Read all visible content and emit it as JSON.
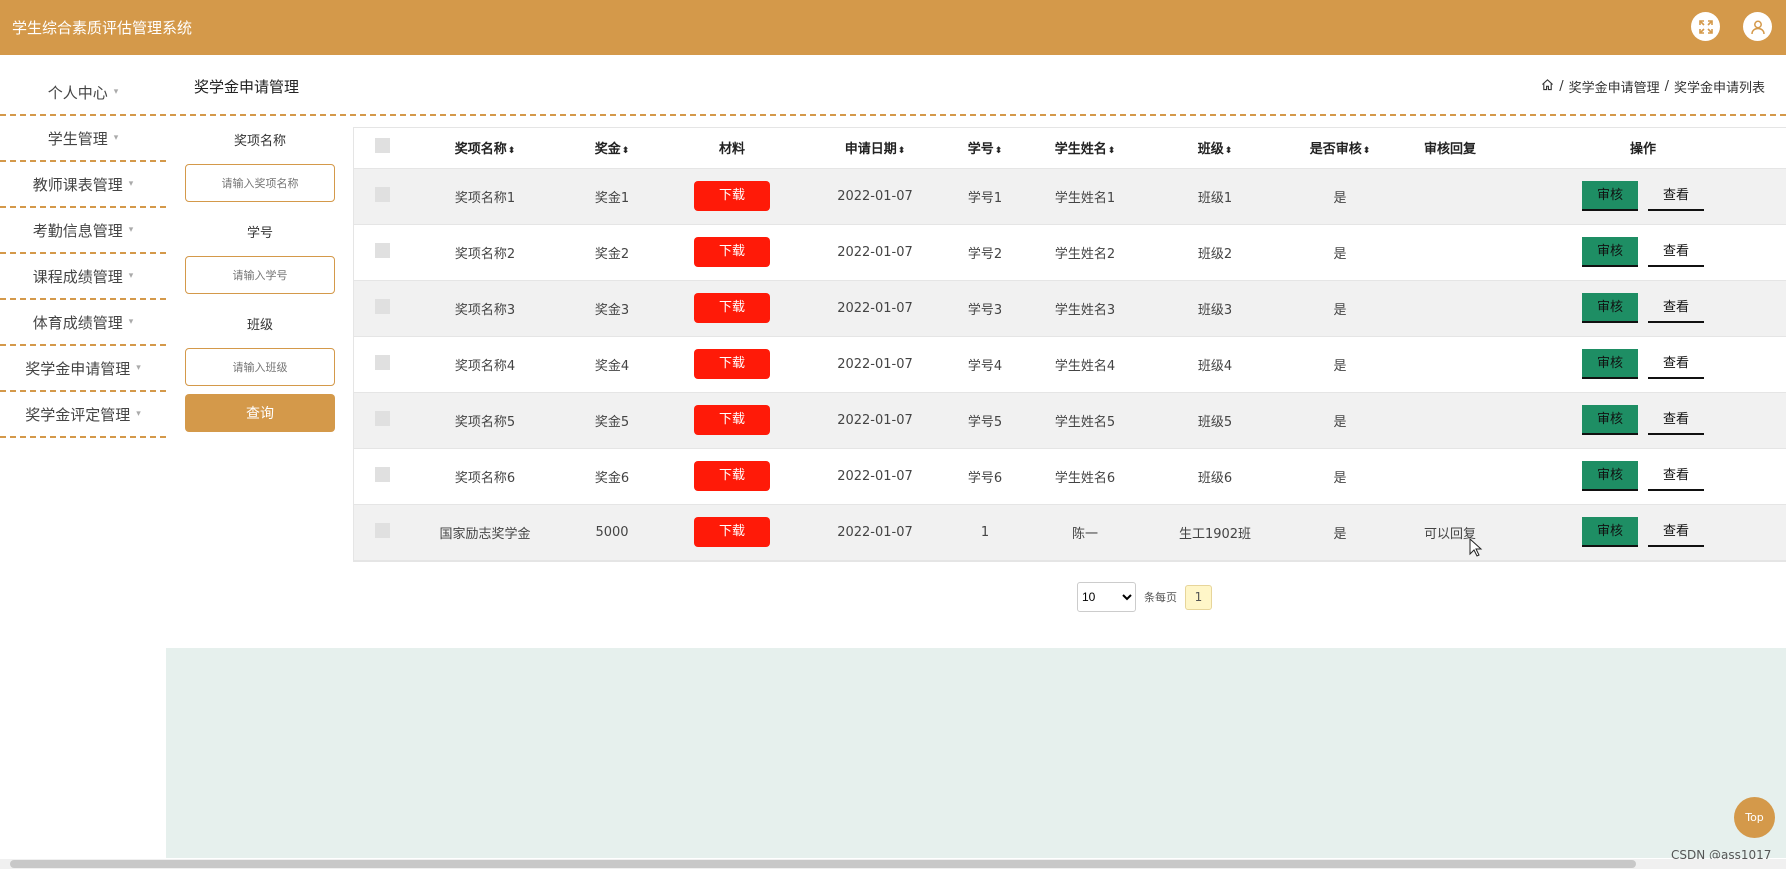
{
  "header": {
    "app_title": "学生综合素质评估管理系统",
    "icons": [
      "fullscreen-icon",
      "user-icon"
    ]
  },
  "sidebar": {
    "items": [
      {
        "label": "个人中心"
      },
      {
        "label": "学生管理"
      },
      {
        "label": "教师课表管理"
      },
      {
        "label": "考勤信息管理"
      },
      {
        "label": "课程成绩管理"
      },
      {
        "label": "体育成绩管理"
      },
      {
        "label": "奖学金申请管理"
      },
      {
        "label": "奖学金评定管理"
      }
    ],
    "caret": "▾"
  },
  "page": {
    "title": "奖学金申请管理",
    "breadcrumb": {
      "level1": "奖学金申请管理",
      "separator": "/",
      "level2": "奖学金申请列表"
    }
  },
  "filters": {
    "award_name": {
      "label": "奖项名称",
      "placeholder": "请输入奖项名称"
    },
    "student_no": {
      "label": "学号",
      "placeholder": "请输入学号"
    },
    "class": {
      "label": "班级",
      "placeholder": "请输入班级"
    },
    "query_label": "查询"
  },
  "table": {
    "headers": {
      "award_name": "奖项名称",
      "bonus": "奖金",
      "material": "材料",
      "apply_date": "申请日期",
      "student_no": "学号",
      "student_name": "学生姓名",
      "class": "班级",
      "reviewed": "是否审核",
      "review_reply": "审核回复",
      "actions": "操作"
    },
    "sort_glyph": "⬍",
    "download_label": "下载",
    "audit_label": "审核",
    "view_label": "查看",
    "rows": [
      {
        "award_name": "奖项名称1",
        "bonus": "奖金1",
        "apply_date": "2022-01-07",
        "student_no": "学号1",
        "student_name": "学生姓名1",
        "class": "班级1",
        "reviewed": "是",
        "review_reply": ""
      },
      {
        "award_name": "奖项名称2",
        "bonus": "奖金2",
        "apply_date": "2022-01-07",
        "student_no": "学号2",
        "student_name": "学生姓名2",
        "class": "班级2",
        "reviewed": "是",
        "review_reply": ""
      },
      {
        "award_name": "奖项名称3",
        "bonus": "奖金3",
        "apply_date": "2022-01-07",
        "student_no": "学号3",
        "student_name": "学生姓名3",
        "class": "班级3",
        "reviewed": "是",
        "review_reply": ""
      },
      {
        "award_name": "奖项名称4",
        "bonus": "奖金4",
        "apply_date": "2022-01-07",
        "student_no": "学号4",
        "student_name": "学生姓名4",
        "class": "班级4",
        "reviewed": "是",
        "review_reply": ""
      },
      {
        "award_name": "奖项名称5",
        "bonus": "奖金5",
        "apply_date": "2022-01-07",
        "student_no": "学号5",
        "student_name": "学生姓名5",
        "class": "班级5",
        "reviewed": "是",
        "review_reply": ""
      },
      {
        "award_name": "奖项名称6",
        "bonus": "奖金6",
        "apply_date": "2022-01-07",
        "student_no": "学号6",
        "student_name": "学生姓名6",
        "class": "班级6",
        "reviewed": "是",
        "review_reply": ""
      },
      {
        "award_name": "国家励志奖学金",
        "bonus": "5000",
        "apply_date": "2022-01-07",
        "student_no": "1",
        "student_name": "陈一",
        "class": "生工1902班",
        "reviewed": "是",
        "review_reply": "可以回复"
      }
    ]
  },
  "pagination": {
    "page_size": "10",
    "per_page_label": "条每页",
    "current_page": "1"
  },
  "misc": {
    "top_label": "Top",
    "watermark": "CSDN @ass1017"
  },
  "colors": {
    "brand": "#d4994a",
    "download": "#ff1a08",
    "audit": "#1e8e64",
    "footer_panel": "#e6f0ed"
  }
}
